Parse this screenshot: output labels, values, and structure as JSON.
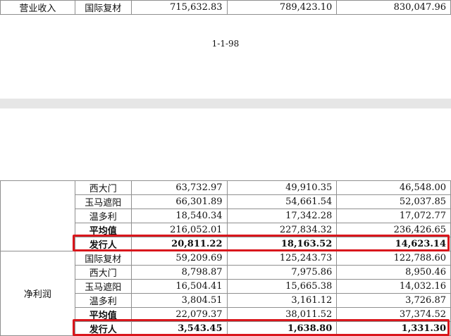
{
  "top_table": {
    "rows": [
      {
        "category": "营业收入",
        "company": "国际复材",
        "v1": "715,632.83",
        "v2": "789,423.10",
        "v3": "830,047.96"
      }
    ]
  },
  "page_number": "1-1-98",
  "bottom_table": {
    "group1": {
      "rows": [
        {
          "company": "西大门",
          "v1": "63,732.97",
          "v2": "49,910.35",
          "v3": "46,548.00"
        },
        {
          "company": "玉马遮阳",
          "v1": "66,301.89",
          "v2": "54,661.54",
          "v3": "52,037.85"
        },
        {
          "company": "温多利",
          "v1": "18,540.34",
          "v2": "17,342.28",
          "v3": "17,072.77"
        },
        {
          "company": "平均值",
          "v1": "216,052.01",
          "v2": "227,834.32",
          "v3": "236,426.65"
        },
        {
          "company": "发行人",
          "v1": "20,811.22",
          "v2": "18,163.52",
          "v3": "14,623.14"
        }
      ]
    },
    "group2": {
      "category": "净利润",
      "rows": [
        {
          "company": "国际复材",
          "v1": "59,209.69",
          "v2": "125,243.73",
          "v3": "122,788.60"
        },
        {
          "company": "西大门",
          "v1": "8,798.87",
          "v2": "7,975.86",
          "v3": "8,950.46"
        },
        {
          "company": "玉马遮阳",
          "v1": "16,504.41",
          "v2": "15,665.38",
          "v3": "14,032.16"
        },
        {
          "company": "温多利",
          "v1": "3,804.51",
          "v2": "3,161.12",
          "v3": "3,726.87"
        },
        {
          "company": "平均值",
          "v1": "22,079.37",
          "v2": "38,011.52",
          "v3": "37,374.52"
        },
        {
          "company": "发行人",
          "v1": "3,543.45",
          "v2": "1,638.80",
          "v3": "1,331.30"
        }
      ]
    }
  },
  "colors": {
    "highlight": "#d9161c",
    "gap": "#e6e6e6",
    "border": "#8f8f8f"
  }
}
